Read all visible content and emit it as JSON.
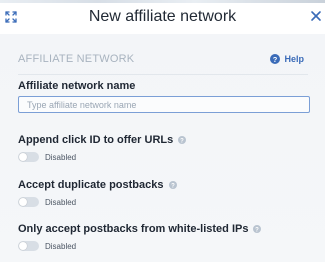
{
  "modal": {
    "title": "New affiliate network",
    "expand_icon": "expand-arrows-icon",
    "close_icon": "close-icon"
  },
  "section": {
    "title": "AFFILIATE NETWORK",
    "help_label": "Help",
    "help_icon": "question-circle-icon"
  },
  "name_field": {
    "label": "Affiliate network name",
    "placeholder": "Type affiliate network name",
    "value": ""
  },
  "toggles": [
    {
      "label": "Append click ID to offer URLs",
      "state": "Disabled",
      "enabled": false
    },
    {
      "label": "Accept duplicate postbacks",
      "state": "Disabled",
      "enabled": false
    },
    {
      "label": "Only accept postbacks from white-listed IPs",
      "state": "Disabled",
      "enabled": false
    }
  ],
  "colors": {
    "accent": "#3a6bb8",
    "panel_background": "#f4f6f8",
    "input_border": "#7b9fd6",
    "toggle_off": "#d8dee5"
  }
}
